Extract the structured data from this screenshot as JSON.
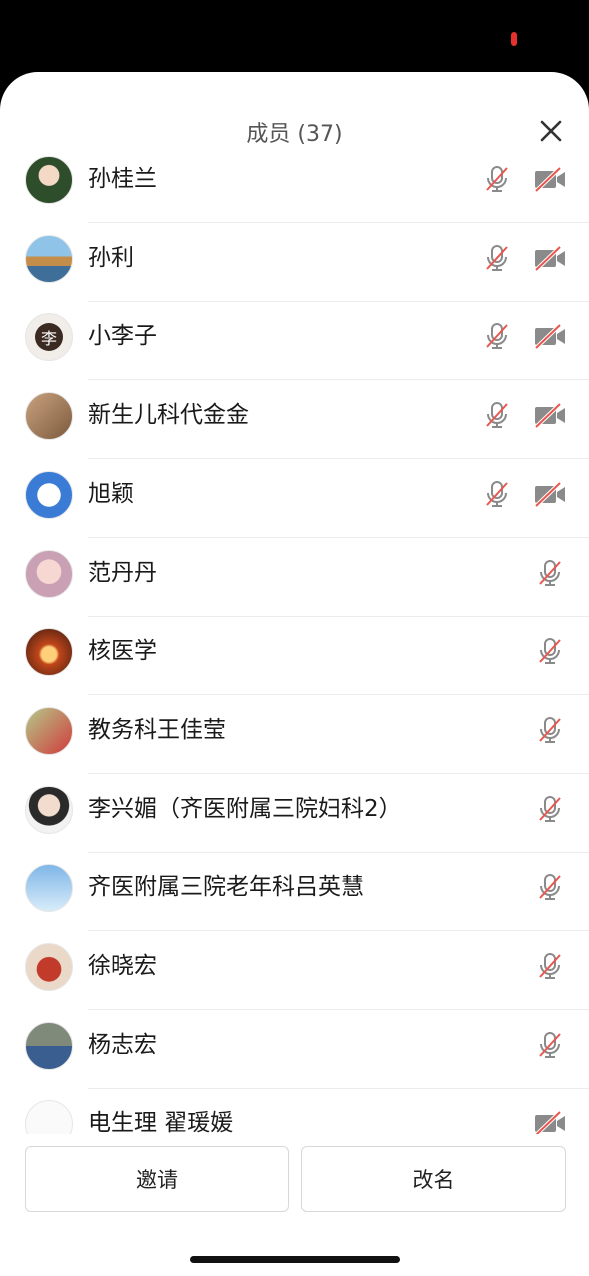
{
  "header": {
    "title": "成员 (37)"
  },
  "members": [
    {
      "name": "孙桂兰",
      "mic_muted": true,
      "camera_off": true
    },
    {
      "name": "孙利",
      "mic_muted": true,
      "camera_off": true
    },
    {
      "name": "小李子",
      "mic_muted": true,
      "camera_off": true,
      "avatar_text": "李"
    },
    {
      "name": "新生儿科代金金",
      "mic_muted": true,
      "camera_off": true
    },
    {
      "name": "旭颖",
      "mic_muted": true,
      "camera_off": true
    },
    {
      "name": "范丹丹",
      "mic_muted": true
    },
    {
      "name": "核医学",
      "mic_muted": true
    },
    {
      "name": "教务科王佳莹",
      "mic_muted": true
    },
    {
      "name": "李兴媚（齐医附属三院妇科2）",
      "mic_muted": true
    },
    {
      "name": "齐医附属三院老年科吕英慧",
      "mic_muted": true
    },
    {
      "name": "徐晓宏",
      "mic_muted": true
    },
    {
      "name": "杨志宏",
      "mic_muted": true
    },
    {
      "name": "电生理 翟瑗媛",
      "camera_off": true
    }
  ],
  "footer": {
    "invite_label": "邀请",
    "rename_label": "改名"
  },
  "colors": {
    "muted_slash": "#e8574f",
    "icon_gray": "#8a8a8a",
    "status_red": "#e5322d"
  }
}
